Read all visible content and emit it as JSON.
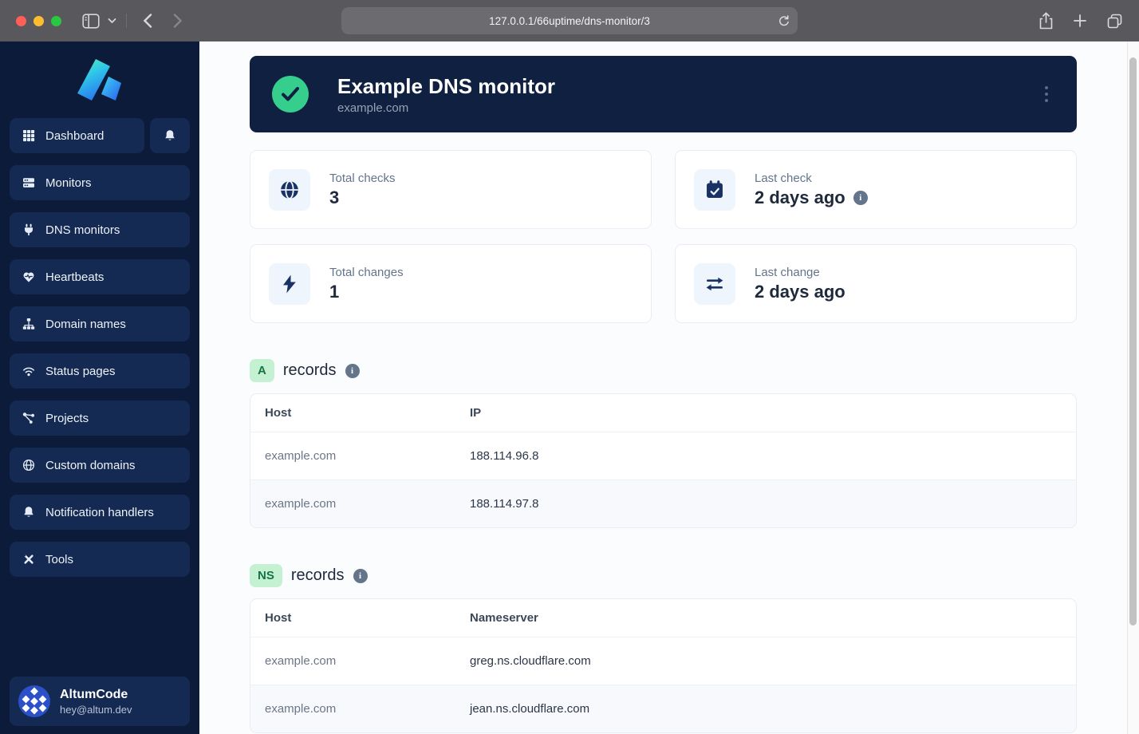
{
  "browser": {
    "url": "127.0.0.1/66uptime/dns-monitor/3"
  },
  "sidebar": {
    "nav": [
      {
        "label": "Dashboard"
      },
      {
        "label": "Monitors"
      },
      {
        "label": "DNS monitors"
      },
      {
        "label": "Heartbeats"
      },
      {
        "label": "Domain names"
      },
      {
        "label": "Status pages"
      },
      {
        "label": "Projects"
      },
      {
        "label": "Custom domains"
      },
      {
        "label": "Notification handlers"
      },
      {
        "label": "Tools"
      }
    ],
    "user": {
      "name": "AltumCode",
      "email": "hey@altum.dev"
    }
  },
  "monitor": {
    "title": "Example DNS monitor",
    "domain": "example.com"
  },
  "stats": {
    "total_checks": {
      "label": "Total checks",
      "value": "3"
    },
    "last_check": {
      "label": "Last check",
      "value": "2 days ago"
    },
    "total_changes": {
      "label": "Total changes",
      "value": "1"
    },
    "last_change": {
      "label": "Last change",
      "value": "2 days ago"
    }
  },
  "info_glyph": "i",
  "a_records": {
    "badge": "A",
    "title": "records",
    "columns": {
      "host": "Host",
      "value": "IP"
    },
    "rows": [
      {
        "host": "example.com",
        "value": "188.114.96.8"
      },
      {
        "host": "example.com",
        "value": "188.114.97.8"
      }
    ]
  },
  "ns_records": {
    "badge": "NS",
    "title": "records",
    "columns": {
      "host": "Host",
      "value": "Nameserver"
    },
    "rows": [
      {
        "host": "example.com",
        "value": "greg.ns.cloudflare.com"
      },
      {
        "host": "example.com",
        "value": "jean.ns.cloudflare.com"
      }
    ]
  },
  "colors": {
    "status_ok_green": "#35ce8d",
    "sidebar_bg": "#0b1b39",
    "hero_bg": "#0f2040",
    "badge_bg": "#c5f1d3",
    "badge_text": "#157347"
  }
}
